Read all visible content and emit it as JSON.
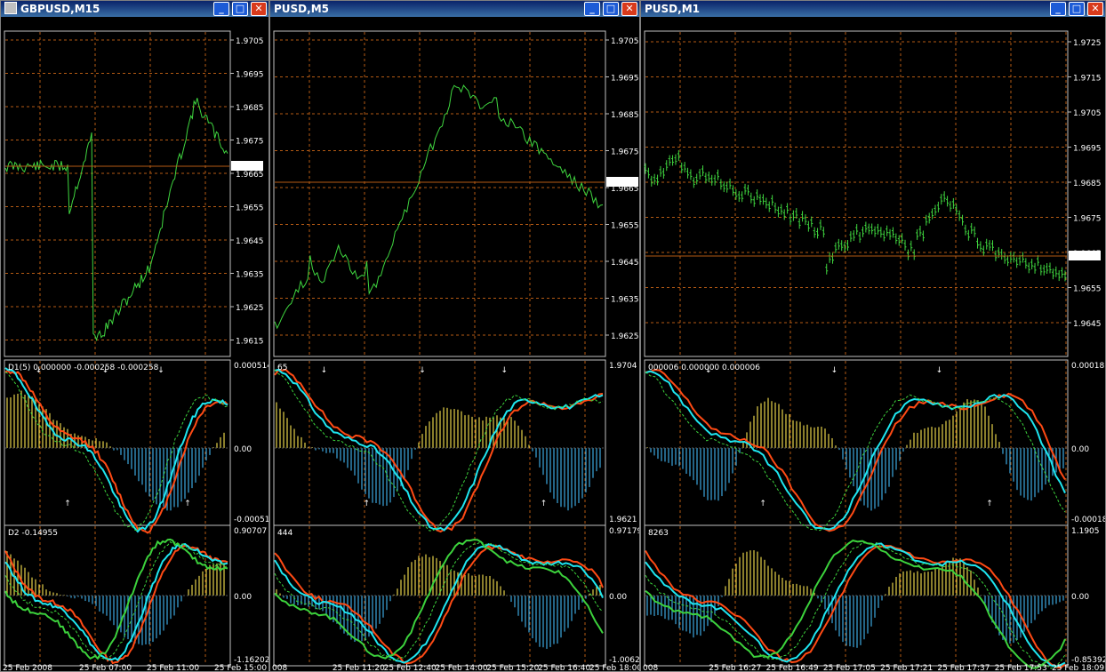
{
  "windows": [
    {
      "title": "GBPUSD,M15",
      "show_icon": true,
      "price_labels": [
        "1.9705",
        "1.9695",
        "1.9685",
        "1.9675",
        "1.9665",
        "1.9655",
        "1.9645",
        "1.9635",
        "1.9625",
        "1.9615"
      ],
      "current_price": "1.9667",
      "ind1_label": "D1(5) 0.000000 -0.000258 -0.000258",
      "ind1_scale": [
        "0.000514",
        "0.00",
        "-0.00051"
      ],
      "ind2_label": "D2 -0.14955",
      "ind2_scale": [
        "0.90707",
        "0.00",
        "-1.16202"
      ],
      "time_labels": [
        "25 Feb 2008",
        "25 Feb 07:00",
        "25 Feb 11:00",
        "25 Feb 15:00"
      ]
    },
    {
      "title": "PUSD,M5",
      "show_icon": false,
      "price_labels": [
        "1.9705",
        "1.9695",
        "1.9685",
        "1.9675",
        "1.9665",
        "1.9655",
        "1.9645",
        "1.9635",
        "1.9625"
      ],
      "current_price": "1.9667",
      "ind1_label": "65",
      "ind1_scale": [
        "1.9704",
        "1.9621"
      ],
      "ind2_label": "444",
      "ind2_scale": [
        "0.97179",
        "0.00",
        "-1.00622"
      ],
      "time_labels": [
        "008",
        "25 Feb 11:20",
        "25 Feb 12:40",
        "25 Feb 14:00",
        "25 Feb 15:20",
        "25 Feb 16:40",
        "25 Feb 18:00"
      ]
    },
    {
      "title": "PUSD,M1",
      "show_icon": false,
      "price_labels": [
        "1.9725",
        "1.9715",
        "1.9705",
        "1.9695",
        "1.9685",
        "1.9675",
        "1.9665",
        "1.9655",
        "1.9645"
      ],
      "current_price": "1.9667",
      "ind1_label": "000006 0.000000 0.000006",
      "ind1_scale": [
        "0.00018",
        "0.00",
        "-0.00018"
      ],
      "ind2_label": "8263",
      "ind2_scale": [
        "1.1905",
        "0.00",
        "-0.85392"
      ],
      "time_labels": [
        "008",
        "25 Feb 16:27",
        "25 Feb 16:49",
        "25 Feb 17:05",
        "25 Feb 17:21",
        "25 Feb 17:37",
        "25 Feb 17:53",
        "25 Feb 18:09"
      ]
    }
  ],
  "window_controls": {
    "minimize": "_",
    "maximize": "□",
    "close": "✕"
  },
  "colors": {
    "background": "#000000",
    "grid": "#b45a14",
    "price_line": "#3fd63f",
    "current_price_line": "#b45a14",
    "histogram_up": "#e6d34a",
    "histogram_down": "#3ca8e0",
    "cyan_line": "#1ee6f0",
    "orange_line": "#ff4a14",
    "green_line": "#3cd23c",
    "arrow_down": "#2a9cff",
    "arrow_up": "#3cd23c"
  }
}
